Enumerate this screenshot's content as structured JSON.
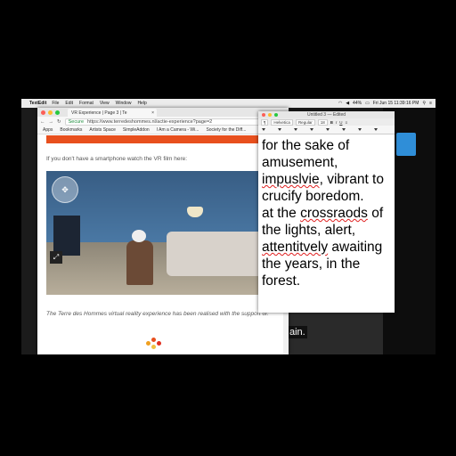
{
  "menubar": {
    "app": "TextEdit",
    "items": [
      "File",
      "Edit",
      "Format",
      "View",
      "Window",
      "Help"
    ],
    "datetime": "Fri Jun 15  11:39:16 PM",
    "battery": "44%"
  },
  "chrome": {
    "tab_title": "VR Experience | Page 3 | Te",
    "url_secure": "Secure",
    "url": "https://www.terredeshommes.nl/actie-experience?page=2",
    "bookmarks": [
      "Apps",
      "Bookmarks",
      "Artists Space",
      "SimpleAddon",
      "I Am a Camera - Wi...",
      "Society for the Diff..."
    ],
    "intro_text": "If you don't have a smartphone watch the VR film here:",
    "credit_text": "The Terre des Hommes virtual reality experience has been realised with the support of:"
  },
  "textedit": {
    "title": "Untitled 3 — Edited",
    "font_name": "Helvetica",
    "font_style": "Regular",
    "font_size": "18",
    "lines": [
      "for the sake of",
      "amusement,",
      "impuslvie, vibrant to",
      "crucify boredom.",
      "at the crossraods of",
      "the lights, alert,",
      "attentitvely awaiting",
      "the years, in the",
      "forest."
    ],
    "misspelled": [
      "impuslvie",
      "crossraods",
      "attentitvely"
    ]
  },
  "video_caption": "ain.",
  "colors": {
    "accent_orange": "#e8501e",
    "desktop_blue": "#2f8ed8"
  }
}
